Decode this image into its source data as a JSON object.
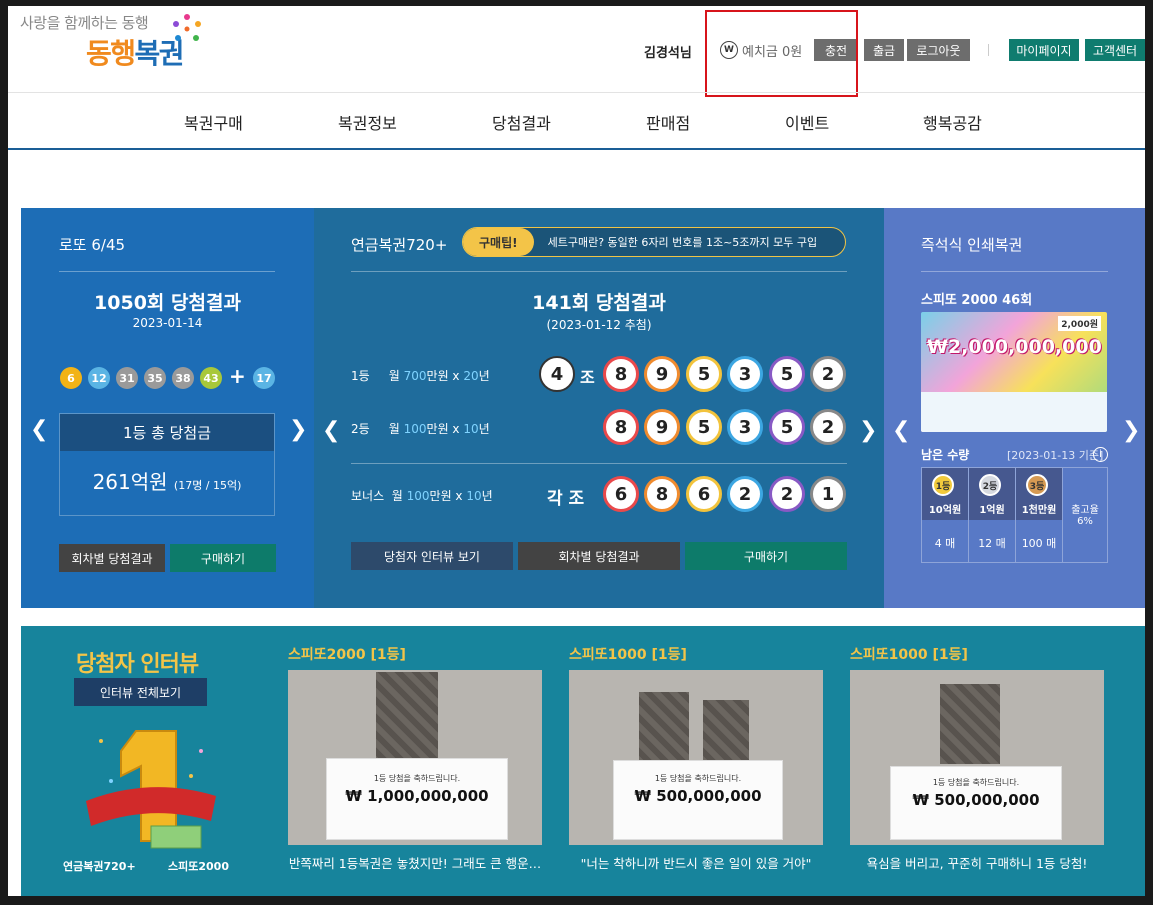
{
  "header": {
    "slogan": "사랑을 함께하는 동행",
    "logo_name_a": "동행",
    "logo_name_b": "복권",
    "username": "김경석님",
    "deposit_icon": "W",
    "deposit_text": "예치금 0원",
    "buttons": {
      "charge": "충전",
      "withdraw": "출금",
      "logout": "로그아웃",
      "mypage": "마이페이지",
      "support": "고객센터"
    }
  },
  "nav": [
    "복권구매",
    "복권정보",
    "당첨결과",
    "판매점",
    "이벤트",
    "행복공감"
  ],
  "lotto": {
    "title": "로또 6/45",
    "round": "1050회 당첨결과",
    "date": "2023-01-14",
    "balls": [
      "6",
      "12",
      "31",
      "35",
      "38",
      "43"
    ],
    "bonus": "17",
    "prize_head": "1등 총 당첨금",
    "prize_amount": "261억원",
    "prize_detail": "(17명 / 15억)",
    "btn_history": "회차별 당첨결과",
    "btn_buy": "구매하기"
  },
  "pension": {
    "title": "연금복권720+",
    "tip_tag": "구매팁!",
    "tip_text": "세트구매란? 동일한 6자리 번호를 1조~5조까지 모두 구입",
    "round": "141회 당첨결과",
    "date": "(2023-01-12 추첨)",
    "rank1": {
      "label": "1등",
      "pre": "월 ",
      "amt": "700",
      "mid": "만원 x ",
      "years": "20",
      "post": "년",
      "group": "4",
      "jo": "조",
      "nums": [
        "8",
        "9",
        "5",
        "3",
        "5",
        "2"
      ]
    },
    "rank2": {
      "label": "2등",
      "pre": "월 ",
      "amt": "100",
      "mid": "만원 x ",
      "years": "10",
      "post": "년",
      "nums": [
        "8",
        "9",
        "5",
        "3",
        "5",
        "2"
      ]
    },
    "bonus": {
      "label": "보너스",
      "pre": "월 ",
      "amt": "100",
      "mid": "만원 x ",
      "years": "10",
      "post": "년",
      "each": "각 조",
      "nums": [
        "6",
        "8",
        "6",
        "2",
        "2",
        "1"
      ]
    },
    "btn_interview": "당첨자 인터뷰 보기",
    "btn_history": "회차별 당첨결과",
    "btn_buy": "구매하기"
  },
  "instant": {
    "title": "즉석식 인쇄복권",
    "ticket_title": "스피또 2000 46회",
    "ticket_amount": "₩2,000,000,000",
    "ticket_price": "2,000원",
    "stock_label": "남은 수량",
    "stock_date": "[2023-01-13 기준]",
    "tiers": [
      {
        "medal": "1등",
        "rank": "10억원",
        "count": "4 매"
      },
      {
        "medal": "2등",
        "rank": "1억원",
        "count": "12 매"
      },
      {
        "medal": "3등",
        "rank": "1천만원",
        "count": "100 매"
      }
    ],
    "rate_label": "출고율",
    "rate_value": "6%"
  },
  "interview": {
    "title": "당첨자 인터뷰",
    "all_btn": "인터뷰 전체보기",
    "logo1": "연금복권720+",
    "logo2": "스피또2000",
    "cards": [
      {
        "title": "스피또2000 [1등]",
        "board_line": "1등 당첨을 축하드립니다.",
        "board_amount": "₩ 1,000,000,000",
        "caption": "반쪽짜리 1등복권은 놓쳤지만! 그래도 큰 행운…"
      },
      {
        "title": "스피또1000 [1등]",
        "board_line": "1등 당첨을 축하드립니다.",
        "board_amount": "₩ 500,000,000",
        "caption": "\"너는 착하니까 반드시 좋은 일이 있을 거야\""
      },
      {
        "title": "스피또1000 [1등]",
        "board_line": "1등 당첨을 축하드립니다.",
        "board_amount": "₩ 500,000,000",
        "caption": "욕심을 버리고, 꾸준히 구매하니 1등 당첨!"
      }
    ]
  },
  "colors": {
    "primary": "#1d6db6",
    "pension": "#1f6c9c",
    "instant": "#5879c6",
    "accent": "#f3c448",
    "highlight": "#d7141b"
  }
}
